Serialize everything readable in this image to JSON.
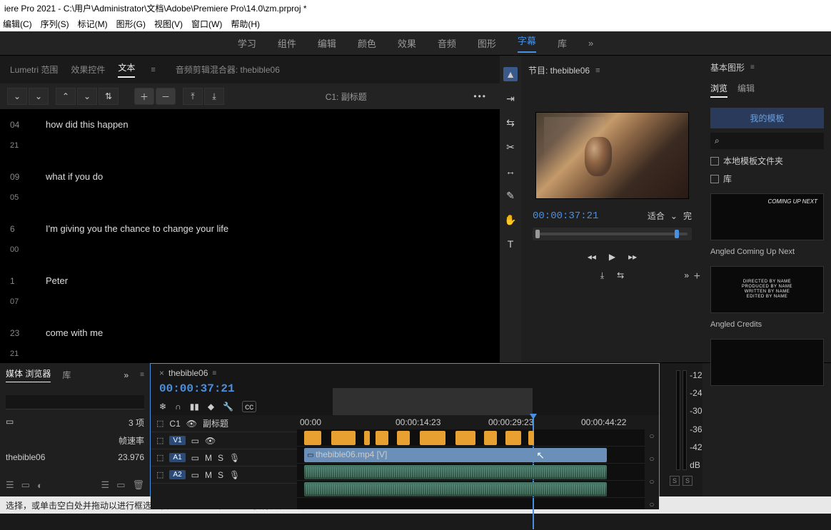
{
  "title": "iere Pro 2021 - C:\\用户\\Administrator\\文档\\Adobe\\Premiere Pro\\14.0\\zm.prproj *",
  "menu": [
    "编辑(C)",
    "序列(S)",
    "标记(M)",
    "图形(G)",
    "视图(V)",
    "窗口(W)",
    "帮助(H)"
  ],
  "workspaces": {
    "items": [
      "学习",
      "组件",
      "编辑",
      "颜色",
      "效果",
      "音频",
      "图形",
      "字幕",
      "库"
    ],
    "active": "字幕",
    "more": "»"
  },
  "left_tabs": {
    "items": [
      "Lumetri 范围",
      "效果控件",
      "文本"
    ],
    "active": "文本",
    "mixer": "音频剪辑混合器: thebible06",
    "opts": "≡"
  },
  "toolbar": {
    "track_label": "C1: 副标题"
  },
  "captions": [
    {
      "in": "04",
      "out": "21",
      "text": "how did this happen"
    },
    {
      "in": "09",
      "out": "05",
      "text": "what if you do"
    },
    {
      "in": "6",
      "out": "00",
      "text": "I'm giving you the chance to change your life"
    },
    {
      "in": "1",
      "out": "07",
      "text": "Peter"
    },
    {
      "in": "23",
      "out": "21",
      "text": "come with me"
    }
  ],
  "program": {
    "title": "节目: thebible06",
    "opts": "≡",
    "tc": "00:00:37:21",
    "fit": "适合",
    "fit_caret": "⌄",
    "zoom": "完"
  },
  "transport": {
    "prev": "◂◂",
    "play": "▶",
    "next": "▸▸",
    "out": "⤓",
    "insert": "⇆",
    "more": "»",
    "plus": "+"
  },
  "egr": {
    "title": "基本图形",
    "opts": "≡",
    "tabs": [
      "浏览",
      "编辑"
    ],
    "active": "浏览",
    "my_templates": "我的模板",
    "search_icon": "⌕",
    "chk1": "本地模板文件夹",
    "chk2": "库",
    "t1": "COMING UP NEXT",
    "t1_name": "Angled Coming Up Next",
    "t2_name": "Angled Credits"
  },
  "media": {
    "tabs": [
      "媒体 浏览器",
      "库"
    ],
    "active": "媒体 浏览器",
    "more": "»",
    "opts": "≡",
    "count": "3 项",
    "col": "帧速率",
    "name": "thebible06",
    "fps": "23.976",
    "icon": "▭"
  },
  "timeline": {
    "seq": "thebible06",
    "opts": "≡",
    "close": "×",
    "tc": "00:00:37:21",
    "tools": [
      "❄",
      "∩",
      "▮▮",
      "◆",
      "🔧",
      "cc"
    ],
    "ruler": [
      "00:00",
      "00:00:14:23",
      "00:00:29:23",
      "00:00:44:22"
    ],
    "tracks": {
      "caption": {
        "lock": "⬚",
        "tag": "C1",
        "eye": "👁",
        "sub": "副标题"
      },
      "v1": {
        "lock": "⬚",
        "tag": "V1",
        "box": "▭",
        "eye": "👁"
      },
      "a1": {
        "lock": "⬚",
        "tag": "A1",
        "box": "▭",
        "m": "M",
        "s": "S",
        "mic": "🎙"
      },
      "a2": {
        "lock": "⬚",
        "tag": "A2",
        "box": "▭",
        "m": "M",
        "s": "S",
        "mic": "🎙"
      }
    },
    "clip_video": "thebible06.mp4 [V]"
  },
  "meters": {
    "labels": [
      "-12",
      "-24",
      "-30",
      "-36",
      "-42",
      "dB"
    ],
    "solo": "S"
  },
  "status": "选择，或单击空白处并拖动以进行框选。使用 Shift、Alt 和 Ctrl 可获得其他选项。"
}
